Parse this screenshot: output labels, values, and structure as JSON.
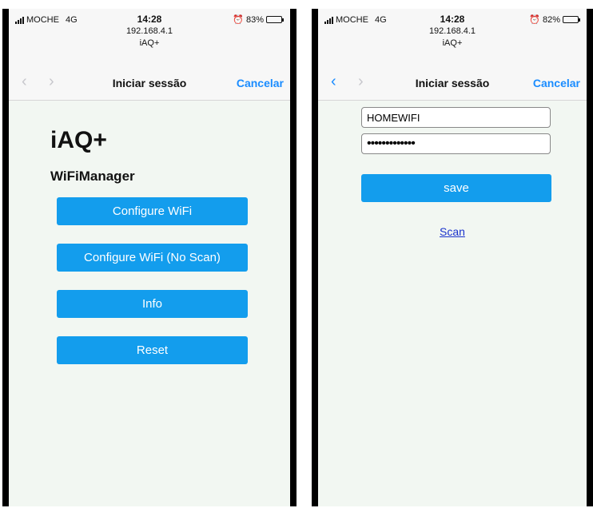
{
  "screens": [
    {
      "status": {
        "carrier": "MOCHE",
        "network": "4G",
        "time": "14:28",
        "url": "192.168.4.1",
        "site": "iAQ+",
        "battery": "83%",
        "battery_level": 0.83
      },
      "nav": {
        "back_icon": "chevron-left-icon",
        "forward_icon": "chevron-right-icon",
        "back_color": "#c7c7cc",
        "title": "Iniciar sessão",
        "cancel": "Cancelar"
      },
      "heading": "iAQ+",
      "subheading": "WiFiManager",
      "buttons": [
        "Configure WiFi",
        "Configure WiFi (No Scan)",
        "Info",
        "Reset"
      ]
    },
    {
      "status": {
        "carrier": "MOCHE",
        "network": "4G",
        "time": "14:28",
        "url": "192.168.4.1",
        "site": "iAQ+",
        "battery": "82%",
        "battery_level": 0.82
      },
      "nav": {
        "back_icon": "chevron-left-icon",
        "forward_icon": "chevron-right-icon",
        "back_color": "#1a8cff",
        "title": "Iniciar sessão",
        "cancel": "Cancelar"
      },
      "ssid": "HOMEWIFI",
      "password_mask": "•••••••••••••",
      "save": "save",
      "scan": "Scan"
    }
  ],
  "colors": {
    "accent": "#139ded",
    "link_blue": "#1a8cff",
    "page_bg": "#f2f7f2"
  }
}
